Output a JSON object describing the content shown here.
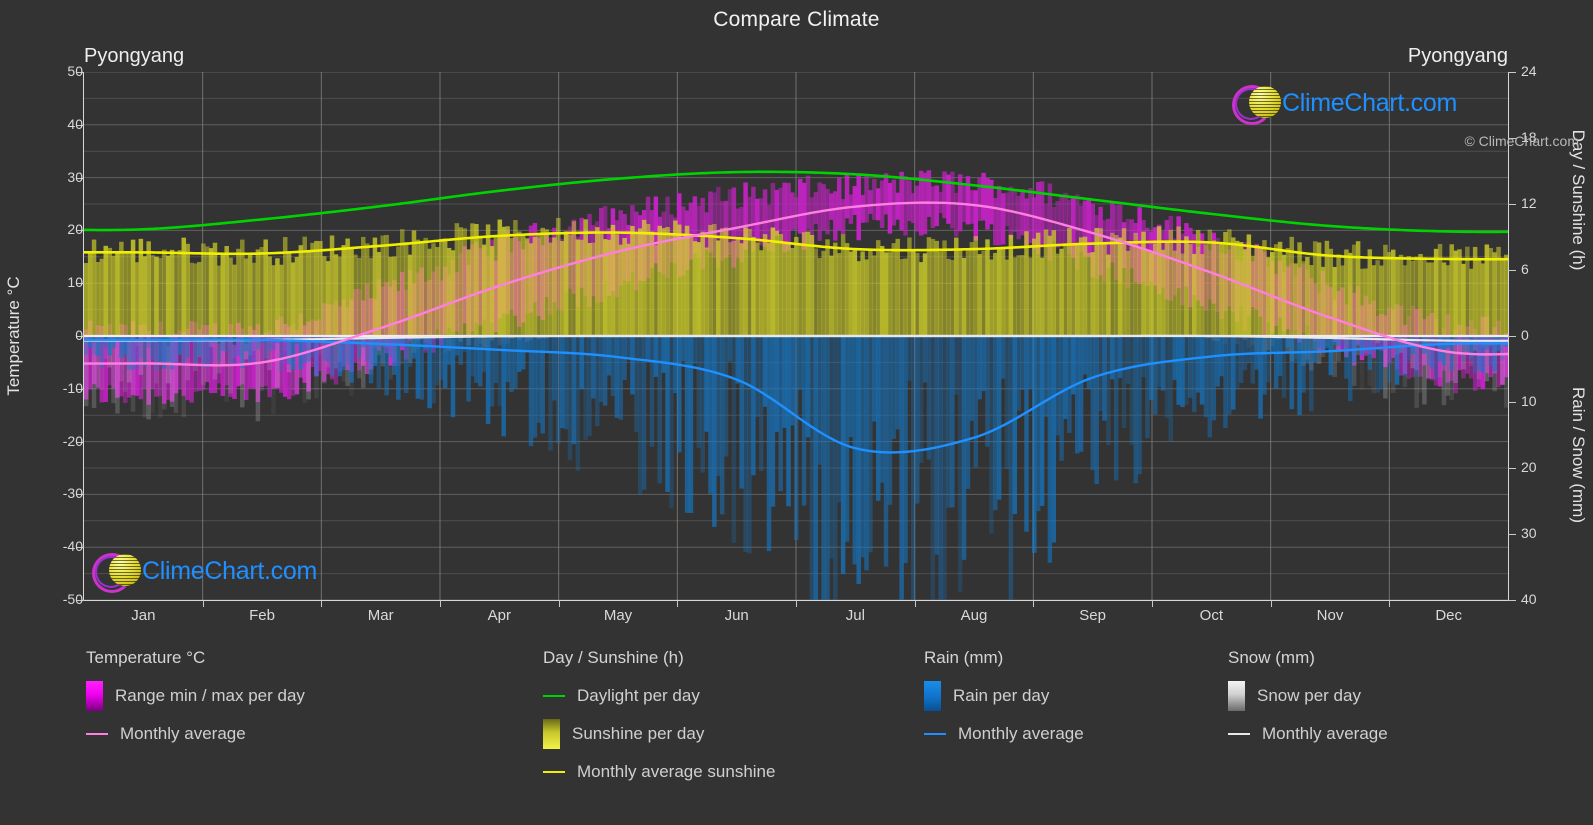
{
  "header": {
    "title": "Compare Climate",
    "city_left": "Pyongyang",
    "city_right": "Pyongyang"
  },
  "watermark": {
    "text": "ClimeChart.com",
    "copyright": "© ClimeChart.com"
  },
  "axes": {
    "left_title": "Temperature °C",
    "right_title_top": "Day / Sunshine (h)",
    "right_title_bottom": "Rain / Snow (mm)",
    "temp_ticks": [
      "50",
      "40",
      "30",
      "20",
      "10",
      "0",
      "-10",
      "-20",
      "-30",
      "-40",
      "-50"
    ],
    "sun_ticks": [
      "24",
      "18",
      "12",
      "6",
      "0"
    ],
    "rain_ticks": [
      "0",
      "10",
      "20",
      "30",
      "40"
    ],
    "months": [
      "Jan",
      "Feb",
      "Mar",
      "Apr",
      "May",
      "Jun",
      "Jul",
      "Aug",
      "Sep",
      "Oct",
      "Nov",
      "Dec"
    ]
  },
  "legend": {
    "groups": [
      {
        "title": "Temperature °C",
        "entries": [
          {
            "label": "Range min / max per day",
            "swatch": "gradient-magenta",
            "color": "#ff00ff"
          },
          {
            "label": "Monthly average",
            "swatch": "line",
            "color": "#ff7fe0"
          }
        ]
      },
      {
        "title": "Day / Sunshine (h)",
        "entries": [
          {
            "label": "Daylight per day",
            "swatch": "line",
            "color": "#00d400"
          },
          {
            "label": "Sunshine per day",
            "swatch": "gradient-yellow",
            "color": "#e8e83c"
          },
          {
            "label": "Monthly average sunshine",
            "swatch": "line",
            "color": "#f0f000"
          }
        ]
      },
      {
        "title": "Rain (mm)",
        "entries": [
          {
            "label": "Rain per day",
            "swatch": "gradient-blue",
            "color": "#0080e0"
          },
          {
            "label": "Monthly average",
            "swatch": "line",
            "color": "#1e90ff"
          }
        ]
      },
      {
        "title": "Snow (mm)",
        "entries": [
          {
            "label": "Snow per day",
            "swatch": "gradient-white",
            "color": "#e8e8e8"
          },
          {
            "label": "Monthly average",
            "swatch": "line",
            "color": "#e8e8e8"
          }
        ]
      }
    ]
  },
  "chart_data": {
    "type": "line",
    "title": "Compare Climate",
    "subtitle": "Pyongyang",
    "xlabel": "",
    "ylabel": "Temperature °C",
    "ylim": [
      -50,
      50
    ],
    "y2_top_label": "Day / Sunshine (h)",
    "y2_top_lim": [
      0,
      24
    ],
    "y2_bottom_label": "Rain / Snow (mm)",
    "y2_bottom_lim": [
      0,
      40
    ],
    "grid": true,
    "legend_position": "below",
    "categories": [
      "Jan",
      "Feb",
      "Mar",
      "Apr",
      "May",
      "Jun",
      "Jul",
      "Aug",
      "Sep",
      "Oct",
      "Nov",
      "Dec"
    ],
    "series": [
      {
        "name": "Monthly average temperature",
        "units": "°C",
        "color": "#ff7fe0",
        "values": [
          -5.2,
          -5.0,
          1.5,
          9.5,
          16.0,
          20.5,
          24.5,
          24.8,
          19.5,
          12.0,
          3.5,
          -3.0
        ]
      },
      {
        "name": "Daylight per day",
        "units": "h",
        "color": "#00d400",
        "axis": "sunshine",
        "values": [
          9.7,
          10.6,
          11.8,
          13.2,
          14.3,
          14.9,
          14.7,
          13.7,
          12.4,
          11.1,
          10.0,
          9.5
        ]
      },
      {
        "name": "Monthly average sunshine",
        "units": "h",
        "color": "#f0f000",
        "axis": "sunshine",
        "values": [
          7.6,
          7.5,
          8.2,
          9.1,
          9.4,
          8.9,
          7.9,
          7.9,
          8.4,
          8.5,
          7.3,
          7.0
        ]
      },
      {
        "name": "Monthly average rain",
        "units": "mm",
        "color": "#1e90ff",
        "axis": "rain",
        "values": [
          0.6,
          0.6,
          1.2,
          2.1,
          3.2,
          6.6,
          17.0,
          15.4,
          6.3,
          3.1,
          2.3,
          1.2
        ]
      },
      {
        "name": "Monthly average snow",
        "units": "mm",
        "color": "#e8e8e8",
        "axis": "rain",
        "values": [
          0.7,
          0.6,
          0.3,
          0.05,
          0.0,
          0.0,
          0.0,
          0.0,
          0.0,
          0.0,
          0.3,
          0.7
        ]
      }
    ],
    "bands": [
      {
        "name": "Temperature range min / max per day",
        "units": "°C",
        "color": "#ff00ff",
        "min": [
          -11.0,
          -10.5,
          -4.0,
          3.0,
          9.5,
          15.5,
          20.5,
          20.5,
          13.5,
          5.5,
          -1.5,
          -8.5
        ],
        "max": [
          0.5,
          1.5,
          8.5,
          17.0,
          23.0,
          26.5,
          28.5,
          29.0,
          25.0,
          18.5,
          9.5,
          2.0
        ]
      },
      {
        "name": "Sunshine per day",
        "units": "h",
        "color": "#e8e83c",
        "min": [
          0,
          0,
          0,
          0,
          0,
          0,
          0,
          0,
          0,
          0,
          0,
          0
        ],
        "max": [
          7.8,
          7.7,
          8.4,
          9.3,
          9.6,
          9.1,
          8.1,
          8.1,
          8.6,
          8.7,
          7.5,
          7.2
        ]
      },
      {
        "name": "Rain per day",
        "units": "mm",
        "color": "#0080e0",
        "min": [
          0,
          0,
          0,
          0,
          0,
          0,
          0,
          0,
          0,
          0,
          0,
          0
        ],
        "max": [
          4,
          4,
          7,
          12,
          18,
          25,
          40,
          38,
          22,
          12,
          9,
          5
        ]
      },
      {
        "name": "Snow per day",
        "units": "mm",
        "color": "#e8e8e8",
        "min": [
          0,
          0,
          0,
          0,
          0,
          0,
          0,
          0,
          0,
          0,
          0,
          0
        ],
        "max": [
          9,
          8,
          5,
          1,
          0,
          0,
          0,
          0,
          0,
          0.5,
          4,
          8
        ]
      }
    ]
  }
}
